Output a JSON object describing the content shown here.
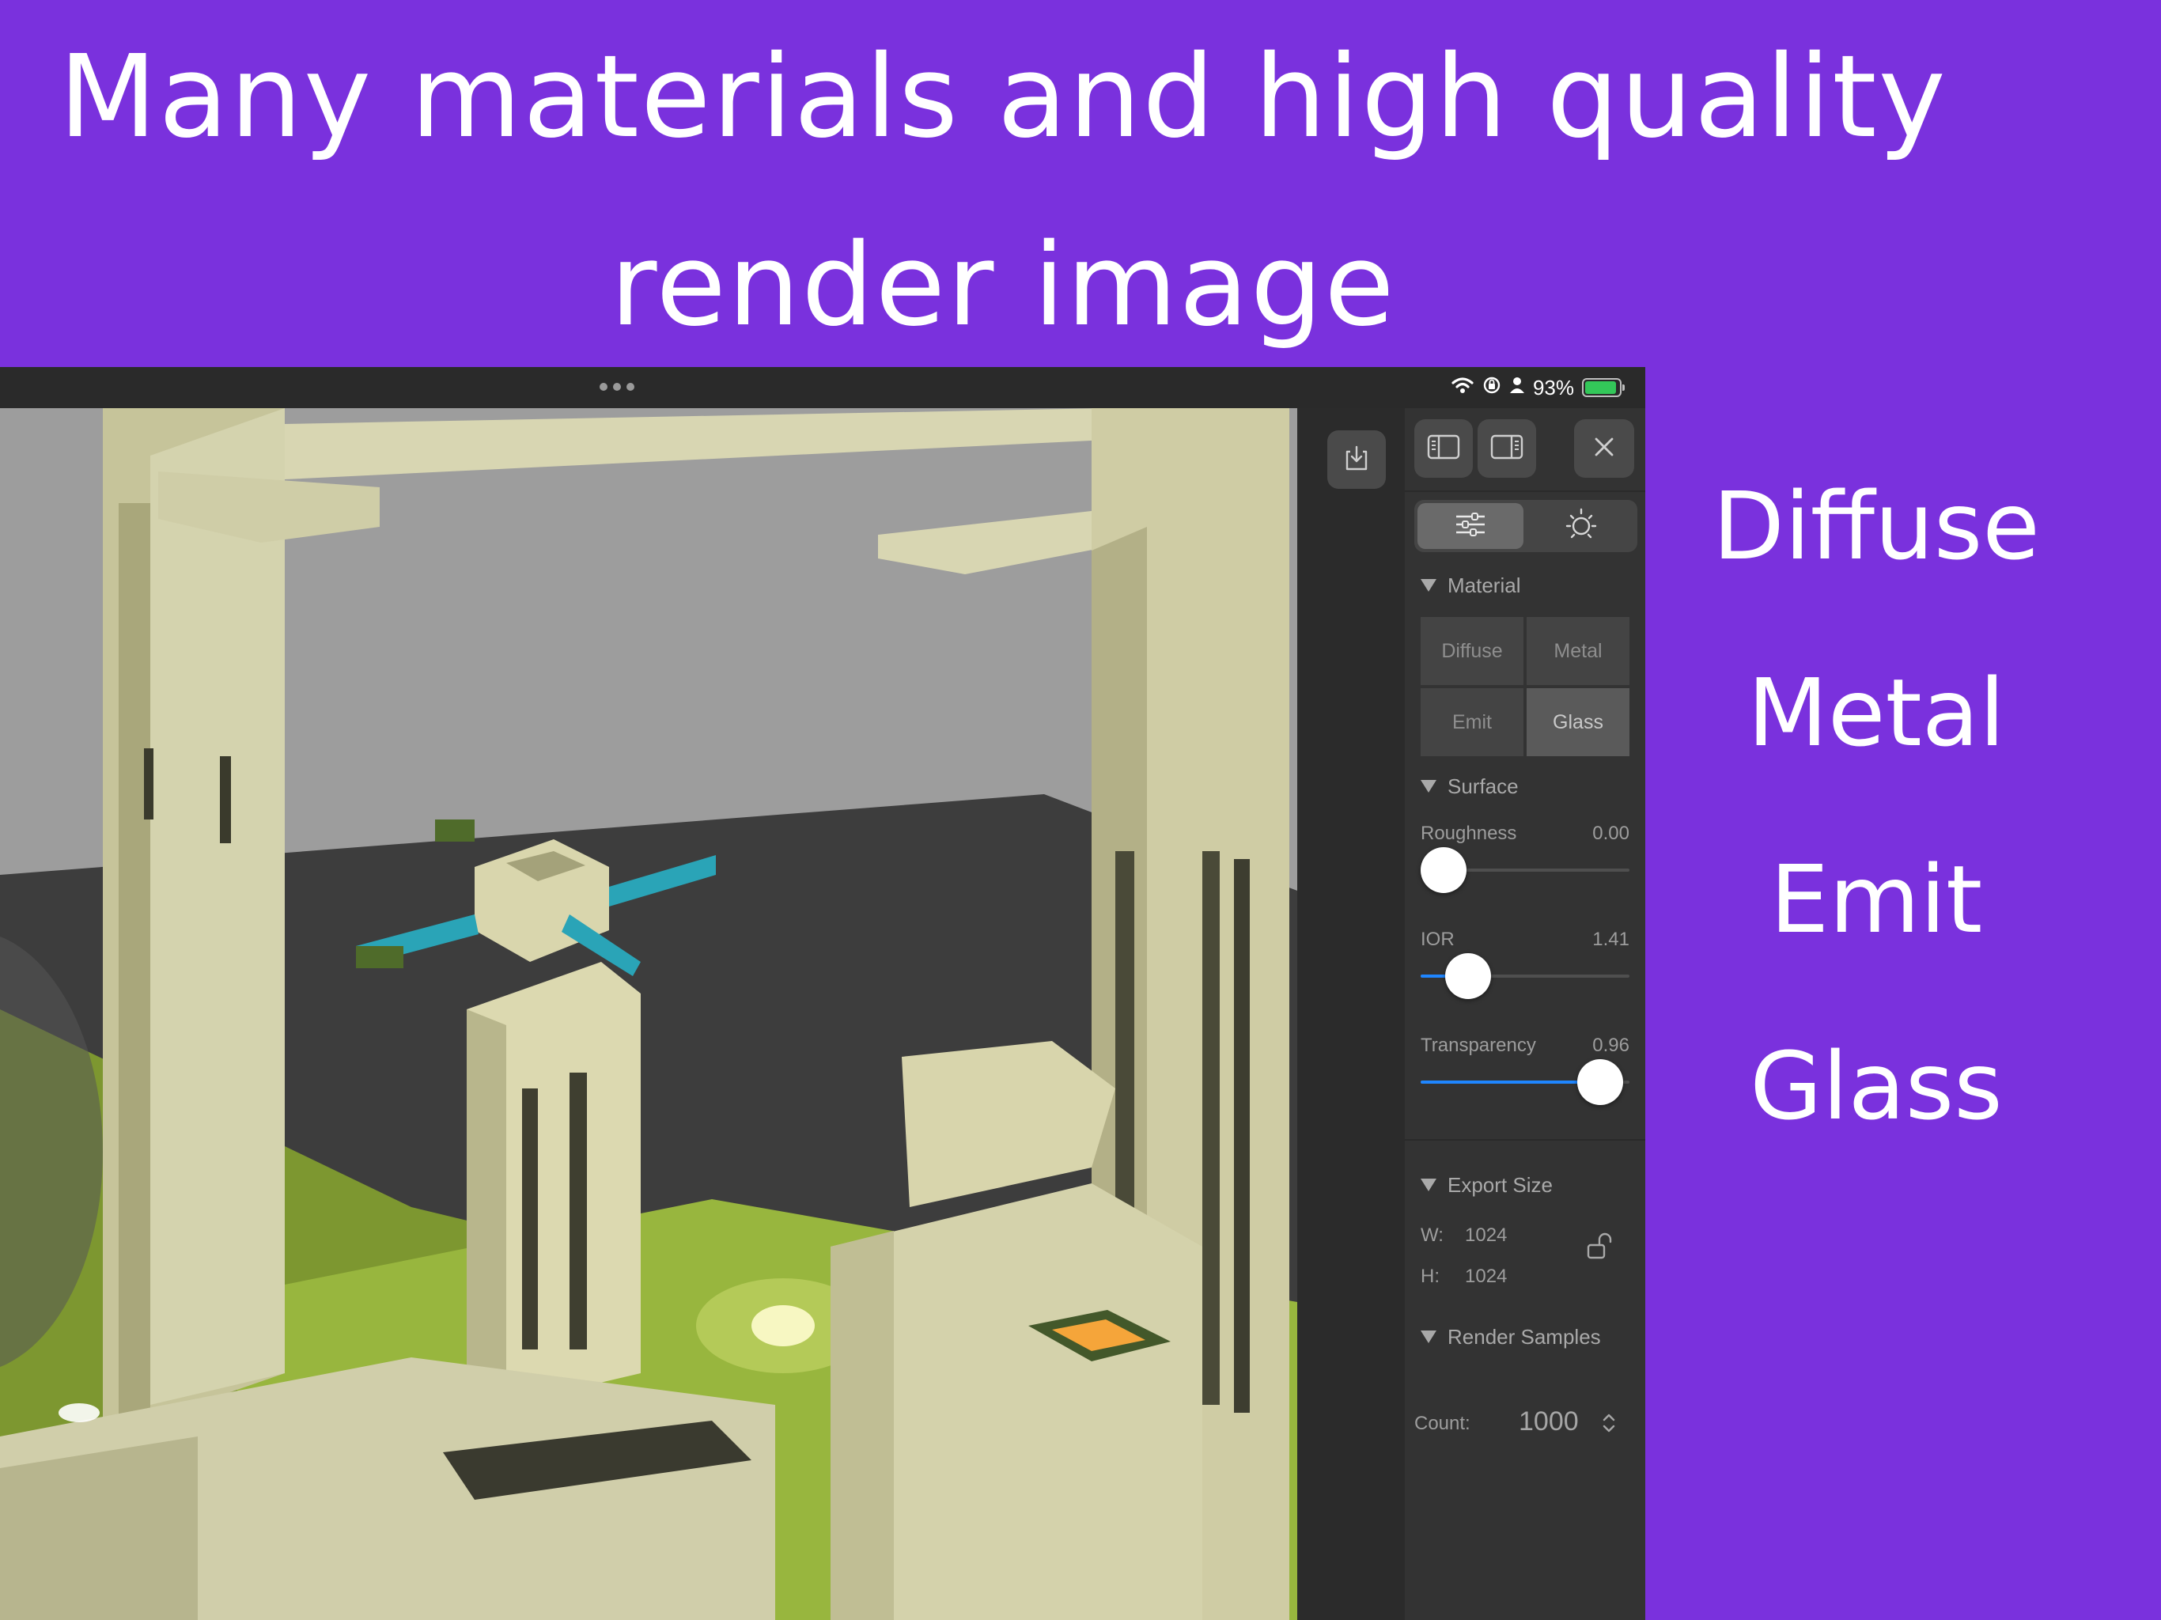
{
  "headline": {
    "line1": "Many materials and high quality",
    "line2": "render image"
  },
  "materials_list": [
    "Diffuse",
    "Metal",
    "Emit",
    "Glass"
  ],
  "status_bar": {
    "battery_percent_text": "93%",
    "battery_level": 0.93,
    "battery_charging": true
  },
  "toolbar": {
    "export_icon": "download-tray-icon",
    "left_panel_icon": "sidebar-left-icon",
    "right_panel_icon": "sidebar-right-icon",
    "close_icon": "close-icon"
  },
  "tabs": [
    {
      "icon": "sliders-icon",
      "active": true
    },
    {
      "icon": "sun-light-icon",
      "active": false
    }
  ],
  "material_section": {
    "title": "Material",
    "options": [
      "Diffuse",
      "Metal",
      "Emit",
      "Glass"
    ],
    "selected": "Glass"
  },
  "surface_section": {
    "title": "Surface",
    "properties": [
      {
        "label": "Roughness",
        "value_text": "0.00",
        "fraction": 0.0
      },
      {
        "label": "IOR",
        "value_text": "1.41",
        "fraction": 0.15
      },
      {
        "label": "Transparency",
        "value_text": "0.96",
        "fraction": 0.96
      }
    ]
  },
  "export_section": {
    "title": "Export Size",
    "width_label": "W:",
    "width_value": "1024",
    "height_label": "H:",
    "height_value": "1024",
    "lock_icon": "unlocked-padlock-icon"
  },
  "render_section": {
    "title": "Render Samples",
    "count_label": "Count:",
    "count_value": "1000"
  },
  "colors": {
    "background": "#7a31dd",
    "panel": "#333333",
    "accent": "#1f86ff",
    "battery": "#33c759"
  }
}
